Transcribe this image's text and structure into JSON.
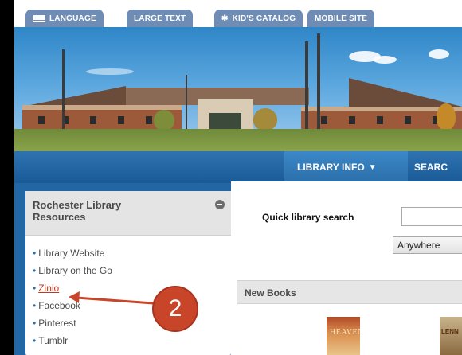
{
  "tabs": [
    {
      "label": "LANGUAGE",
      "icon": "flag-icon"
    },
    {
      "label": "LARGE TEXT"
    },
    {
      "label": "KID'S CATALOG",
      "icon": "star-icon"
    },
    {
      "label": "MOBILE SITE"
    }
  ],
  "nav": {
    "library_info": "LIBRARY INFO",
    "library_info_caret": "▼",
    "search": "SEARC"
  },
  "sidebar": {
    "title": "Rochester Library Resources",
    "items": [
      {
        "label": "Library Website"
      },
      {
        "label": "Library on the Go"
      },
      {
        "label": "Zinio"
      },
      {
        "label": "Facebook"
      },
      {
        "label": "Pinterest"
      },
      {
        "label": "Tumblr"
      }
    ]
  },
  "search": {
    "label": "Quick library search",
    "input_value": "",
    "scope_selected": "Anywhere"
  },
  "new_books": {
    "title": "New Books",
    "books": [
      {
        "cover_text": "HEAVEN'S DITCH"
      },
      {
        "cover_text": "LENN"
      }
    ]
  },
  "annotation": {
    "badge_number": "2"
  },
  "colors": {
    "tab_bg": "#6f8db4",
    "navbar": "#195a97",
    "body_blue": "#2266a3",
    "link_active": "#c23a1e",
    "badge": "#c8452a"
  }
}
